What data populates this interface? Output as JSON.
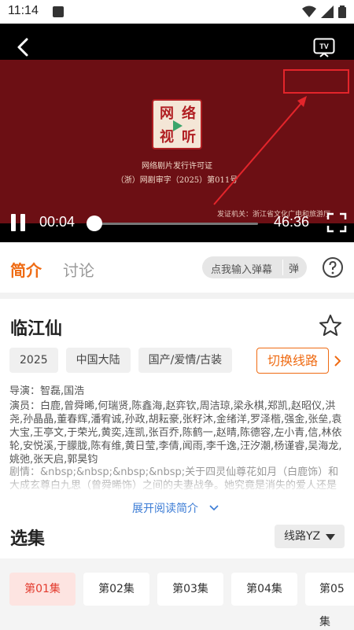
{
  "status_bar": {
    "time": "11:14"
  },
  "video": {
    "seal_chars": [
      "网",
      "络",
      "视",
      "听"
    ],
    "license_title": "网络剧片发行许可证",
    "license_number": "（浙）网剧审字（2025）第011号",
    "issuer": "发证机关：浙江省文化广电和旅游厅",
    "tv_label": "TV",
    "current_time": "00:04",
    "duration": "46:36",
    "progress": 0.0014
  },
  "tabs": {
    "intro": "简介",
    "discussion": "讨论",
    "danmu_placeholder": "点我输入弹幕",
    "danmu_button": "弹"
  },
  "show": {
    "title": "临江仙",
    "tags": [
      "2025",
      "中国大陆",
      "国产/爱情/古装"
    ],
    "switch_route": "切换线路",
    "director": "导演：智磊,国浩",
    "cast": "演员：白鹿,曾舜晞,何瑞贤,陈鑫海,赵弈钦,周洁琼,梁永棋,郑凯,赵昭仪,洪尧,孙晶晶,董春辉,潘宥诚,孙政,胡耘豪,张籽沐,金绪洋,罗泽楷,强金,张垒,袁大宝,王亭文,于荣光,黄奕,连凯,张百乔,陈鹤一,赵晴,陈德容,左小青,信,林依轮,安悦溪,于朦胧,陈有维,黄日莹,李倩,闻雨,李千逸,汪汐潮,杨谨睿,吴海龙,姚弛,张天启,郭昊钧",
    "plot": "剧情：&nbsp;&nbsp;&nbsp;&nbsp;关于四灵仙尊花如月（白鹿饰）和大成玄尊白九思（曾舜晞饰）之间的夫妻战争。她究竟是消失的爱人还是前世死敌，他又是要找回爱人还是要报复仇人……",
    "expand": "展开阅读简介"
  },
  "episodes": {
    "title": "选集",
    "route": "线路YZ",
    "items": [
      "第01集",
      "第02集",
      "第03集",
      "第04集",
      "第05集"
    ]
  },
  "colors": {
    "accent": "#ef6b13",
    "annotation": "#e3252b",
    "selected_episode_text": "#e33b2e",
    "link": "#3a7bd5"
  }
}
